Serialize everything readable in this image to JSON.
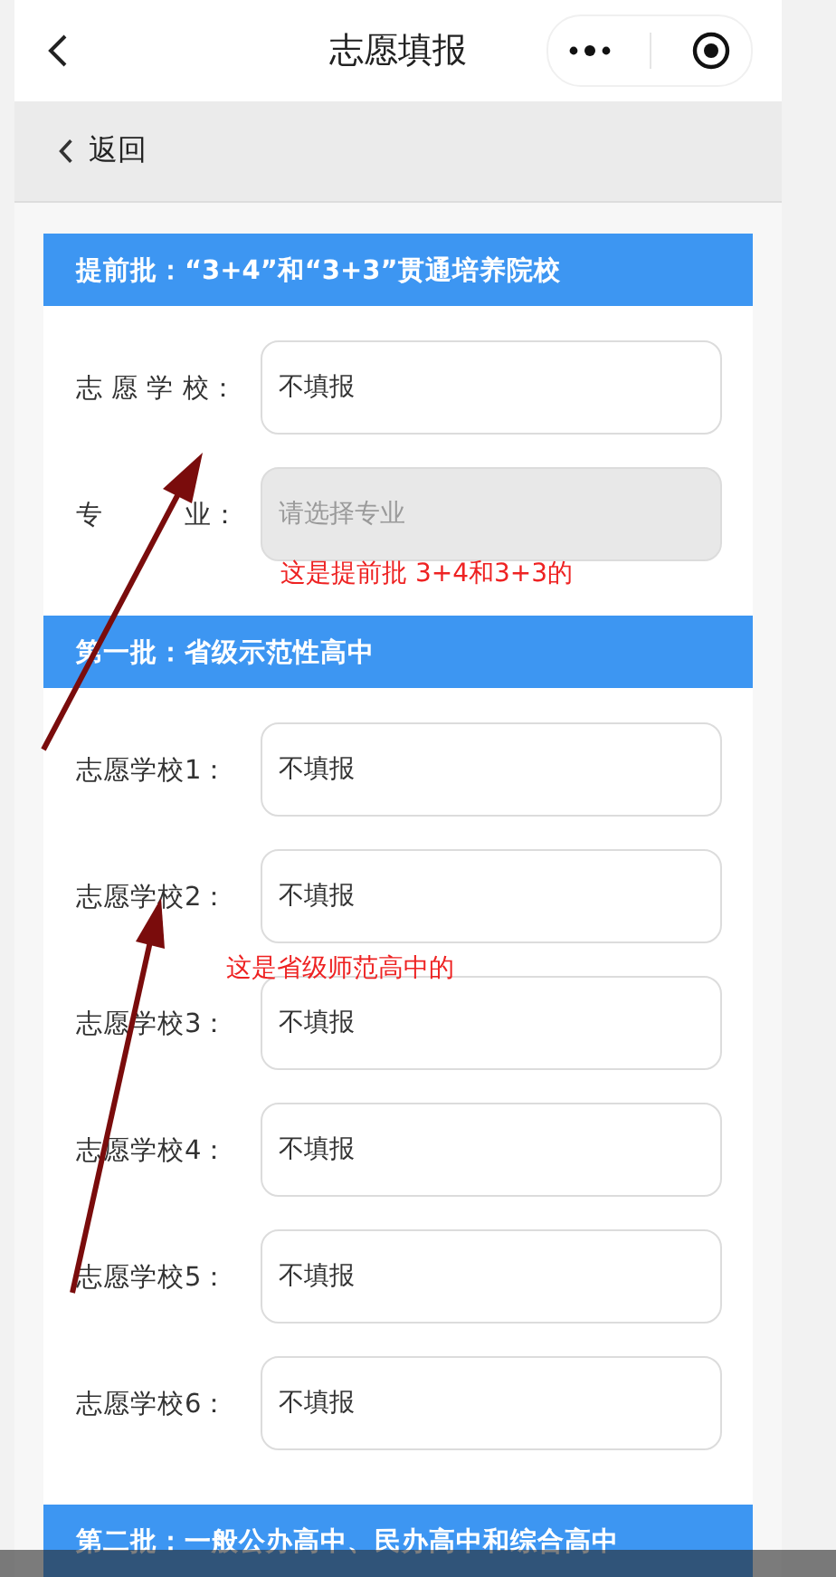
{
  "nav": {
    "title": "志愿填报"
  },
  "back": {
    "label": "返回"
  },
  "sections": [
    {
      "title": "提前批：“3+4”和“3+3”贯通培养院校",
      "rows": [
        {
          "label": "志 愿 学 校：",
          "value": "不填报",
          "disabled": false
        },
        {
          "label": "专　　　业：",
          "placeholder": "请选择专业",
          "disabled": true
        }
      ]
    },
    {
      "title": "第一批：省级示范性高中",
      "rows": [
        {
          "label": "志愿学校1：",
          "value": "不填报",
          "disabled": false
        },
        {
          "label": "志愿学校2：",
          "value": "不填报",
          "disabled": false
        },
        {
          "label": "志愿学校3：",
          "value": "不填报",
          "disabled": false
        },
        {
          "label": "志愿学校4：",
          "value": "不填报",
          "disabled": false
        },
        {
          "label": "志愿学校5：",
          "value": "不填报",
          "disabled": false
        },
        {
          "label": "志愿学校6：",
          "value": "不填报",
          "disabled": false
        }
      ]
    },
    {
      "title": "第二批：一般公办高中、民办高中和综合高中"
    }
  ],
  "annotations": [
    {
      "text": "这是提前批 3+4和3+3的"
    },
    {
      "text": "这是省级师范高中的"
    }
  ]
}
